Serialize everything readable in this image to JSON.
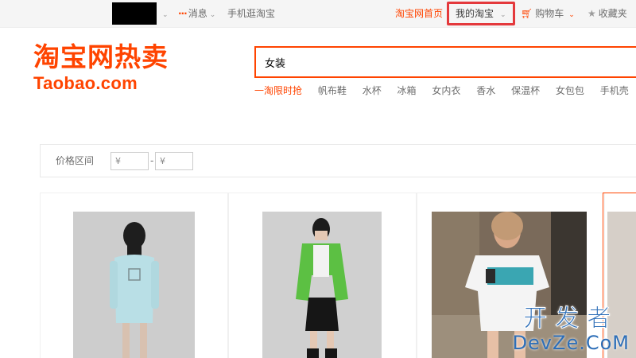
{
  "topbar": {
    "messages": "消息",
    "mobile": "手机逛淘宝",
    "home": "淘宝网首页",
    "my_taobao": "我的淘宝",
    "cart": "购物车",
    "favorites": "收藏夹"
  },
  "logo": {
    "cn": "淘宝网热卖",
    "en": "Taobao.com"
  },
  "search": {
    "value": "女装"
  },
  "hot_links": [
    "一淘限时抢",
    "帆布鞋",
    "水杯",
    "冰箱",
    "女内衣",
    "香水",
    "保温杯",
    "女包包",
    "手机壳"
  ],
  "filter": {
    "label": "价格区间",
    "min_placeholder": "¥",
    "max_placeholder": "¥",
    "dash": "-"
  },
  "watermark": {
    "cn": "开发者",
    "en": "DevZe.CoM"
  },
  "colors": {
    "brand": "#ff4400",
    "highlight_box": "#e4393c",
    "watermark": "#2e6fb8"
  }
}
